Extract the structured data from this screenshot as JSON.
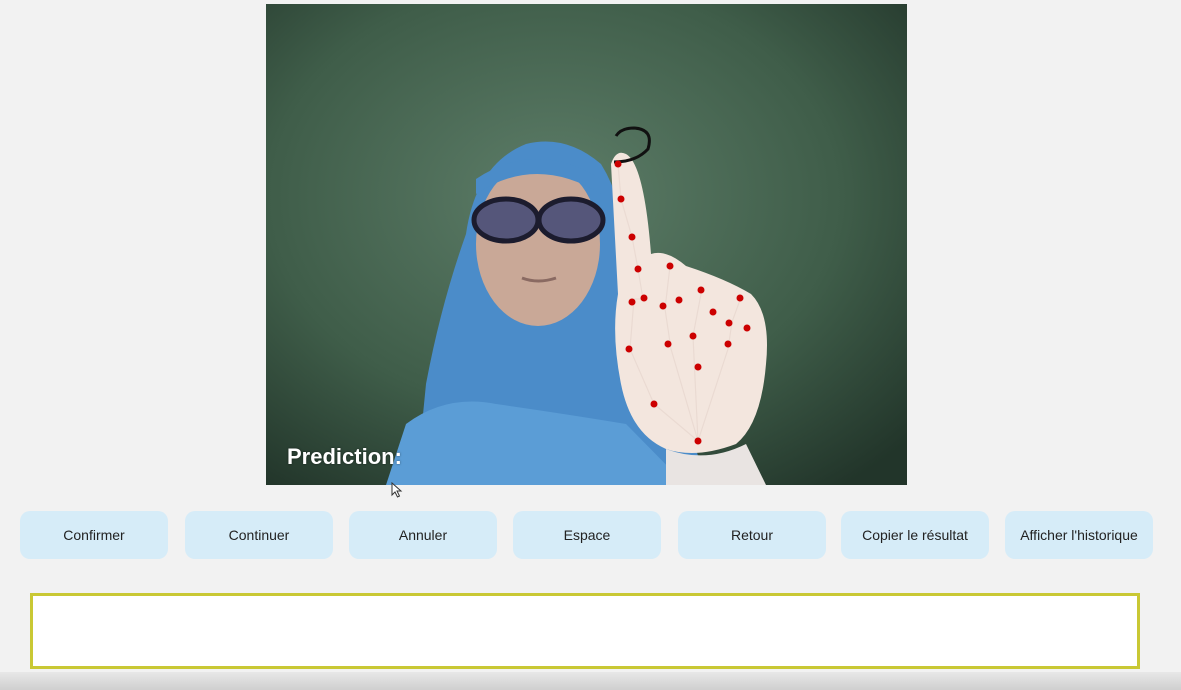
{
  "video": {
    "prediction_label": "Prediction:"
  },
  "buttons": [
    {
      "label": "Confirmer"
    },
    {
      "label": "Continuer"
    },
    {
      "label": "Annuler"
    },
    {
      "label": "Espace"
    },
    {
      "label": "Retour"
    },
    {
      "label": "Copier le résultat"
    },
    {
      "label": "Afficher l'historique"
    }
  ],
  "result": {
    "value": ""
  },
  "colors": {
    "button_bg": "#d6ecf8",
    "result_border": "#c9c834",
    "landmark": "#cc0000"
  }
}
